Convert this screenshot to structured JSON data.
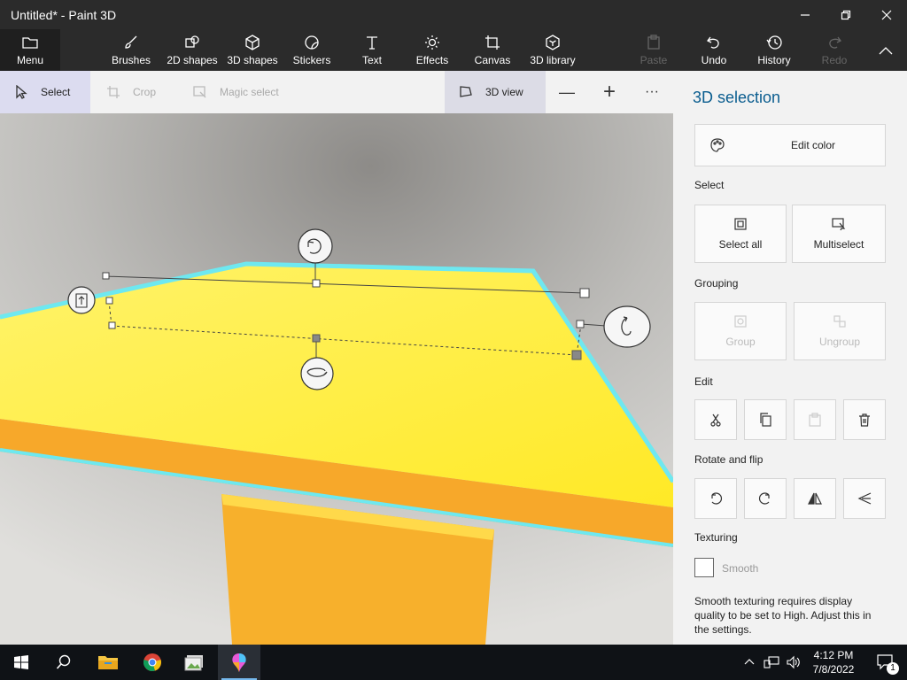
{
  "window": {
    "title": "Untitled* - Paint 3D"
  },
  "ribbon": {
    "menu_label": "Menu",
    "tabs": [
      {
        "label": "Brushes",
        "icon": "brush-icon"
      },
      {
        "label": "2D shapes",
        "icon": "2d-shapes-icon"
      },
      {
        "label": "3D shapes",
        "icon": "3d-shapes-icon"
      },
      {
        "label": "Stickers",
        "icon": "stickers-icon"
      },
      {
        "label": "Text",
        "icon": "text-icon"
      },
      {
        "label": "Effects",
        "icon": "effects-icon"
      },
      {
        "label": "Canvas",
        "icon": "canvas-icon"
      },
      {
        "label": "3D library",
        "icon": "3d-library-icon"
      }
    ],
    "paste_label": "Paste",
    "undo_label": "Undo",
    "history_label": "History",
    "redo_label": "Redo"
  },
  "toolbar": {
    "select_label": "Select",
    "crop_label": "Crop",
    "magic_select_label": "Magic select",
    "view_label": "3D view",
    "zoom_out_glyph": "—",
    "zoom_in_glyph": "+",
    "more_glyph": "···"
  },
  "panel": {
    "title": "3D selection",
    "edit_color_label": "Edit color",
    "select_section": "Select",
    "select_all_label": "Select all",
    "multiselect_label": "Multiselect",
    "grouping_section": "Grouping",
    "group_label": "Group",
    "ungroup_label": "Ungroup",
    "edit_section": "Edit",
    "rotate_section": "Rotate and flip",
    "texturing_section": "Texturing",
    "smooth_label": "Smooth",
    "smooth_note": "Smooth texturing requires display quality to be set to High. Adjust this in the settings."
  },
  "taskbar": {
    "time": "4:12 PM",
    "date": "7/8/2022",
    "notification_count": "1"
  },
  "colors": {
    "accent": "#0a5d8f",
    "object_yellow": "#fff04a",
    "object_orange": "#f7a82a",
    "selection_outline": "#6ee8f0"
  }
}
